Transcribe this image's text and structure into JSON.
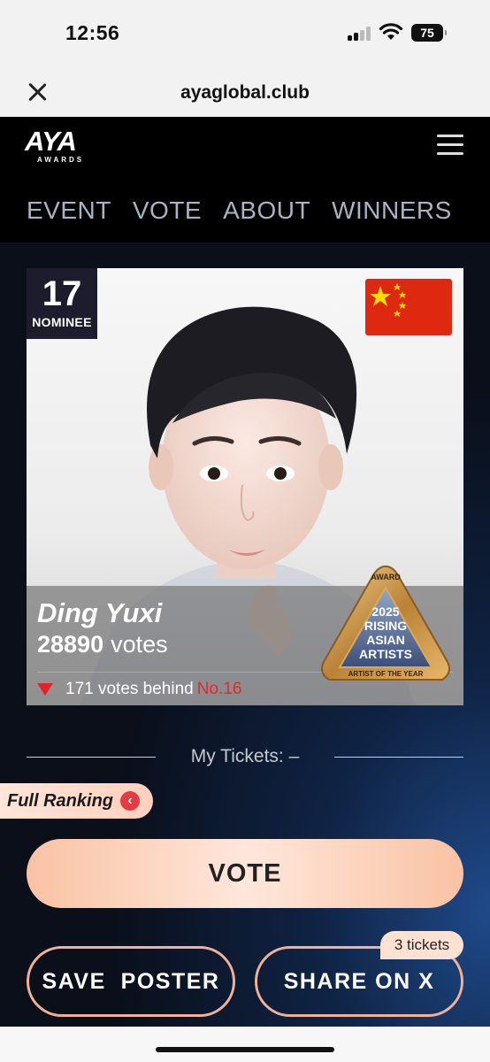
{
  "status_bar": {
    "time": "12:56",
    "battery": "75"
  },
  "browser": {
    "url": "ayaglobal.club"
  },
  "site": {
    "logo_text": "AYA",
    "logo_subtext": "AWARDS",
    "nav": [
      "EVENT",
      "VOTE",
      "ABOUT",
      "WINNERS"
    ]
  },
  "nominee": {
    "number": "17",
    "badge_label": "NOMINEE",
    "name": "Ding Yuxi",
    "votes": "28890",
    "votes_label": "votes",
    "behind_text": "171 votes behind",
    "behind_target": "No.16",
    "flag": "china-flag"
  },
  "award_badge": {
    "top_text": "AWARD",
    "year": "2025",
    "line1": "RISING",
    "line2": "ASIAN",
    "line3": "ARTISTS",
    "ring_text": "ARTIST OF THE YEAR"
  },
  "tickets": {
    "label": "My Tickets: –"
  },
  "full_ranking": {
    "label": "Full Ranking"
  },
  "buttons": {
    "vote": "VOTE",
    "save_poster": "SAVE  POSTER",
    "share_x": "SHARE ON X",
    "share_badge": "3 tickets"
  },
  "colors": {
    "accent_peach": "#f9c2a4",
    "down_red": "#e2232a",
    "header_bg": "#000000",
    "nav_text": "#a9b3c4"
  }
}
